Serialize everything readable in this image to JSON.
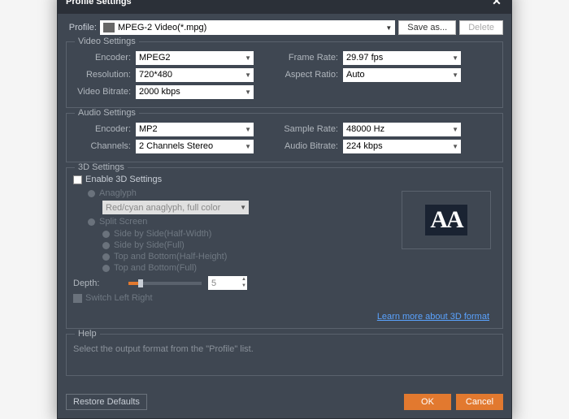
{
  "title": "Profile Settings",
  "profile": {
    "label": "Profile:",
    "value": "MPEG-2 Video(*.mpg)",
    "saveAs": "Save as...",
    "delete": "Delete"
  },
  "video": {
    "title": "Video Settings",
    "encoderLabel": "Encoder:",
    "encoder": "MPEG2",
    "frameRateLabel": "Frame Rate:",
    "frameRate": "29.97 fps",
    "resolutionLabel": "Resolution:",
    "resolution": "720*480",
    "aspectLabel": "Aspect Ratio:",
    "aspect": "Auto",
    "bitrateLabel": "Video Bitrate:",
    "bitrate": "2000 kbps"
  },
  "audio": {
    "title": "Audio Settings",
    "encoderLabel": "Encoder:",
    "encoder": "MP2",
    "sampleLabel": "Sample Rate:",
    "sample": "48000 Hz",
    "channelsLabel": "Channels:",
    "channels": "2 Channels Stereo",
    "bitrateLabel": "Audio Bitrate:",
    "bitrate": "224 kbps"
  },
  "threed": {
    "title": "3D Settings",
    "enable": "Enable 3D Settings",
    "anaglyph": "Anaglyph",
    "anaglyphMode": "Red/cyan anaglyph, full color",
    "split": "Split Screen",
    "sbsHalf": "Side by Side(Half-Width)",
    "sbsFull": "Side by Side(Full)",
    "tbHalf": "Top and Bottom(Half-Height)",
    "tbFull": "Top and Bottom(Full)",
    "depthLabel": "Depth:",
    "depthValue": "5",
    "switchLR": "Switch Left Right",
    "previewText": "AA",
    "learnMore": "Learn more about 3D format"
  },
  "help": {
    "title": "Help",
    "text": "Select the output format from the \"Profile\" list."
  },
  "footer": {
    "restore": "Restore Defaults",
    "ok": "OK",
    "cancel": "Cancel"
  }
}
